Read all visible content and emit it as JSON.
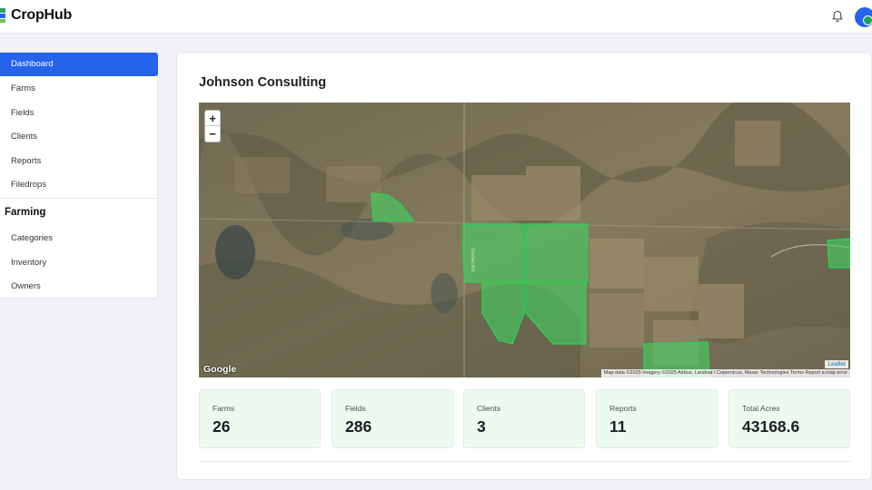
{
  "app": {
    "name": "CropHub"
  },
  "header": {
    "notifications_icon": "bell-icon",
    "avatar_badge_icon": "shield-badge-icon"
  },
  "sidebar": {
    "items": [
      {
        "label": "Dashboard",
        "active": true
      },
      {
        "label": "Farms"
      },
      {
        "label": "Fields"
      },
      {
        "label": "Clients"
      },
      {
        "label": "Reports"
      },
      {
        "label": "Filedrops"
      }
    ],
    "section_heading": "Farming",
    "section_items": [
      {
        "label": "Categories"
      },
      {
        "label": "Inventory"
      },
      {
        "label": "Owners"
      }
    ]
  },
  "main": {
    "title": "Johnson Consulting",
    "map": {
      "zoom_in": "+",
      "zoom_out": "−",
      "provider_logo": "Google",
      "leaflet_label": "Leaflet",
      "attribution": "Map data ©2025 Imagery ©2025 Airbus, Landsat / Copernicus, Maxar Technologies   Terms   Report a map error",
      "road_label": "Gruber Rd"
    },
    "stats": [
      {
        "label": "Farms",
        "value": "26"
      },
      {
        "label": "Fields",
        "value": "286"
      },
      {
        "label": "Clients",
        "value": "3"
      },
      {
        "label": "Reports",
        "value": "11"
      },
      {
        "label": "Total Acres",
        "value": "43168.6"
      }
    ]
  },
  "colors": {
    "accent": "#2563eb",
    "field_overlay": "#3ddc62",
    "stat_bg": "#eefaf0"
  }
}
